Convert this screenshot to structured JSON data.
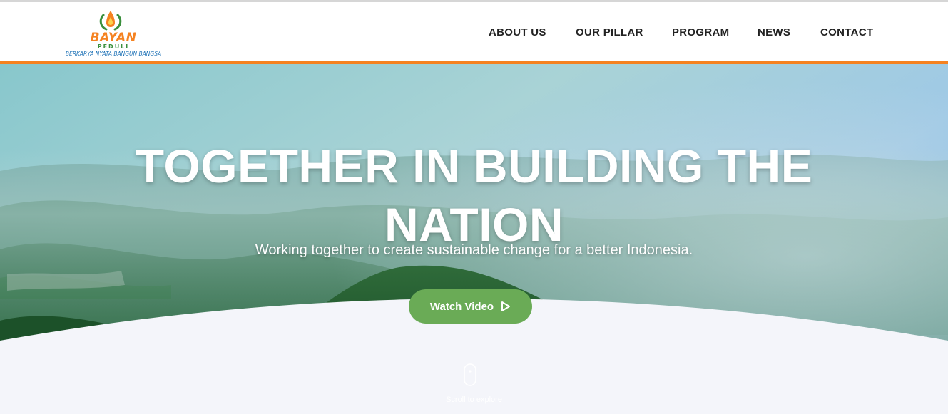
{
  "brand": {
    "name": "BAYAN",
    "sub": "PEDULI",
    "tagline": "BERKARYA NYATA BANGUN BANGSA",
    "colors": {
      "orange": "#f58220",
      "green": "#3a8f3c",
      "blue": "#1f73b7"
    }
  },
  "nav": {
    "items": [
      {
        "label": "ABOUT US"
      },
      {
        "label": "OUR PILLAR"
      },
      {
        "label": "PROGRAM"
      },
      {
        "label": "NEWS"
      },
      {
        "label": "CONTACT"
      }
    ]
  },
  "hero": {
    "title_line1": "TOGETHER IN BUILDING THE",
    "title_line2": "NATION",
    "subtitle": "Working together to create sustainable change for a better Indonesia.",
    "cta_label": "Watch Video",
    "cta_icon": "play-icon",
    "scroll_label": "Scroll to explore",
    "scroll_icon": "mouse-icon",
    "accent_color": "#6aab56"
  }
}
